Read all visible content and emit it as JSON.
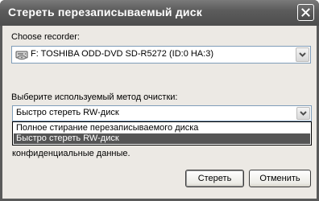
{
  "window": {
    "title": "Стереть перезаписываемый диск"
  },
  "recorder": {
    "label": "Choose recorder:",
    "selected": "F: TOSHIBA  ODD-DVD SD-R5272 (ID:0 HA:3)",
    "icon": "optical-drive-icon"
  },
  "method": {
    "label": "Выберите используемый метод очистки:",
    "selected": "Быстро стереть RW-диск",
    "options": [
      "Полное стирание перезаписываемого диска",
      "Быстро стереть RW-диск"
    ],
    "highlighted_index": 1
  },
  "description": {
    "line2": "конфиденциальные данные."
  },
  "buttons": {
    "erase": "Стереть",
    "cancel": "Отменить"
  }
}
